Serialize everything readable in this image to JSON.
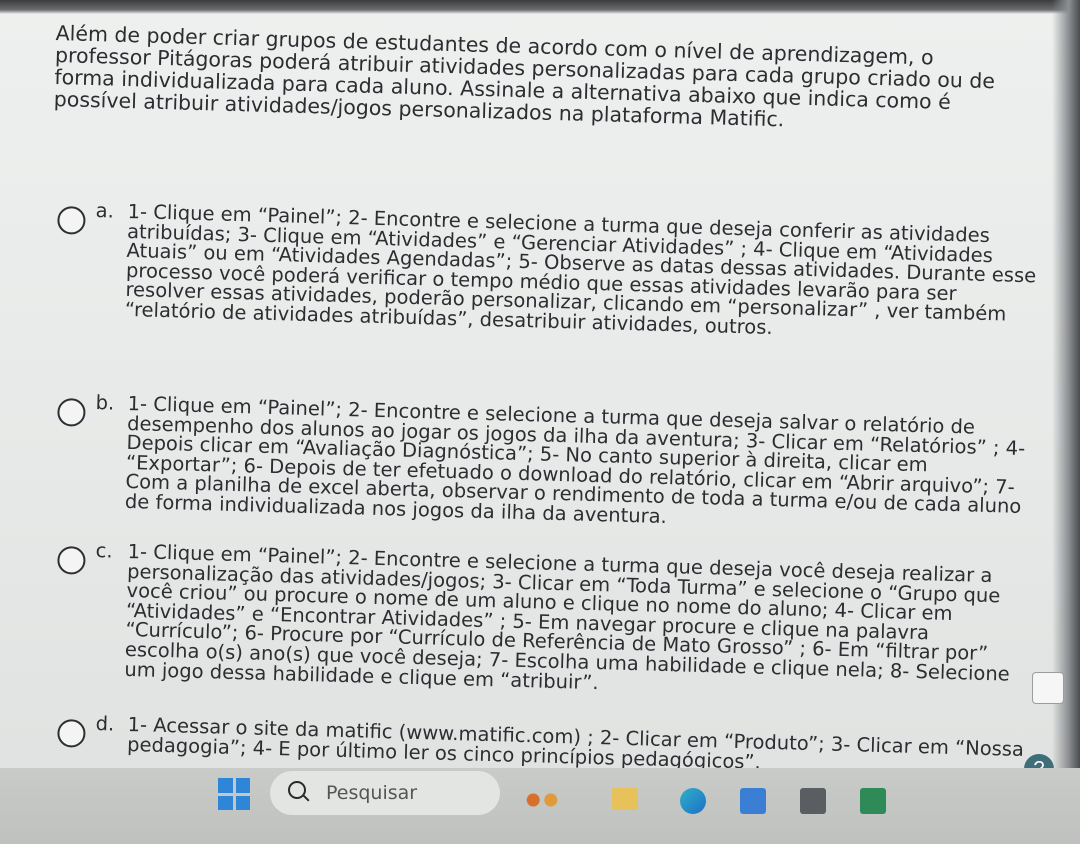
{
  "question": {
    "text": "Além de poder criar grupos de estudantes de acordo com o nível de aprendizagem, o professor Pitágoras poderá atribuir atividades personalizadas para cada grupo criado ou de forma individualizada para cada aluno. Assinale a alternativa abaixo que indica como é possível atribuir atividades/jogos personalizados na plataforma Matific."
  },
  "options": [
    {
      "letter": "a.",
      "text": "1- Clique em “Painel”; 2- Encontre e selecione a turma que deseja conferir as atividades atribuídas; 3- Clique em “Atividades” e “Gerenciar Atividades” ; 4- Clique em “Atividades Atuais” ou em “Atividades Agendadas”; 5- Observe as datas dessas atividades. Durante esse processo você poderá verificar o tempo médio que essas atividades levarão para ser resolver essas atividades, poderão personalizar, clicando em “personalizar” , ver também “relatório de atividades atribuídas”, desatribuir atividades, outros."
    },
    {
      "letter": "b.",
      "text": "1- Clique em “Painel”; 2- Encontre e selecione a turma que deseja salvar o relatório de desempenho dos alunos ao jogar os jogos da ilha da aventura; 3- Clicar em “Relatórios” ; 4- Depois clicar em “Avaliação Diagnóstica”; 5- No canto superior à direita, clicar em “Exportar”; 6- Depois de ter efetuado o download do relatório, clicar em “Abrir arquivo”; 7- Com a planilha de excel aberta, observar o rendimento de toda a turma e/ou de cada aluno de forma individualizada nos jogos da ilha da aventura."
    },
    {
      "letter": "c.",
      "text": "1- Clique em “Painel”; 2- Encontre e selecione a turma que deseja você deseja realizar a personalização das atividades/jogos; 3- Clicar em “Toda Turma” e selecione o “Grupo que você criou” ou procure o nome de um aluno e clique no nome do aluno; 4- Clicar em “Atividades” e “Encontrar Atividades” ; 5- Em navegar procure e clique na palavra “Currículo”; 6- Procure por “Currículo de Referência de Mato Grosso” ; 6- Em “filtrar por” escolha o(s) ano(s) que você deseja; 7- Escolha uma habilidade e clique nela; 8- Selecione um jogo dessa habilidade e clique em “atribuir”."
    },
    {
      "letter": "d.",
      "text": "1- Acessar o site da matific (www.matific.com) ; 2- Clicar em “Produto”; 3- Clicar em “Nossa pedagogia”; 4- E por último ler os cinco princípios pedagógicos”."
    }
  ],
  "help_label": "?",
  "taskbar": {
    "search_placeholder": "Pesquisar"
  }
}
